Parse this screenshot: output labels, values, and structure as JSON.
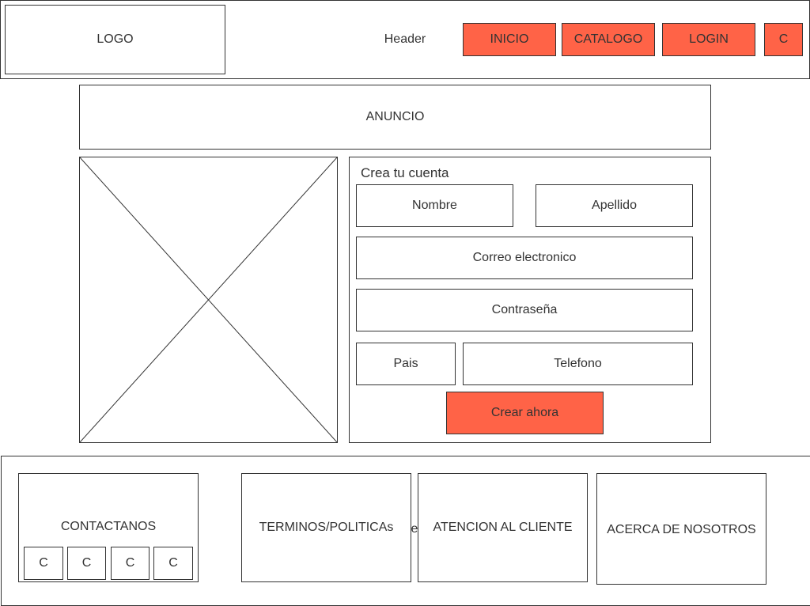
{
  "header": {
    "logo": "LOGO",
    "label": "Header",
    "nav": [
      "INICIO",
      "CATALOGO",
      "LOGIN",
      "C"
    ]
  },
  "ad": {
    "label": "ANUNCIO"
  },
  "form": {
    "title": "Crea tu cuenta",
    "fields": {
      "first_name": "Nombre",
      "last_name": "Apellido",
      "email": "Correo electronico",
      "password": "Contraseña",
      "country": "Pais",
      "phone": "Telefono"
    },
    "submit": "Crear ahora"
  },
  "footer": {
    "contact": {
      "label": "CONTACTANOS",
      "icons": [
        "C",
        "C",
        "C",
        "C"
      ]
    },
    "terms": "TERMINOS/POLITICAs",
    "support": "ATENCION AL CLIENTE",
    "about": "ACERCA DE NOSOTROS",
    "stray_text": "te"
  },
  "colors": {
    "accent": "#ff6347",
    "border": "#333333",
    "text": "#333333"
  }
}
